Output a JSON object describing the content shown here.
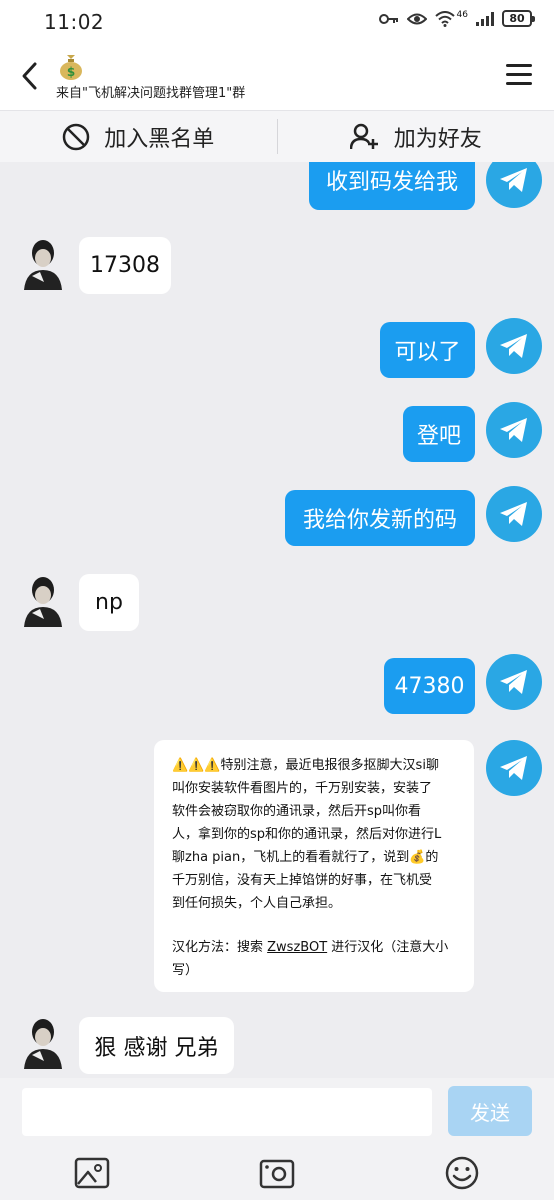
{
  "status_bar": {
    "time": "11:02",
    "battery": "80",
    "network": "46"
  },
  "header": {
    "subtitle": "来自\"飞机解决问题找群管理1\"群",
    "avatar_icon": "money-bag-icon"
  },
  "actions": {
    "blacklist_label": "加入黑名单",
    "add_friend_label": "加为好友"
  },
  "messages": {
    "m1": "收到码发给我",
    "m2": "17308",
    "m3": "可以了",
    "m4": "登吧",
    "m5": "我给你发新的码",
    "m6": "np",
    "m7": "47380",
    "m9": "狠 感谢 兄弟"
  },
  "notice": {
    "line1": "⚠️⚠️⚠️特别注意，最近电报很多抠脚大汉si聊",
    "line2": "叫你安装软件看图片的，千万别安装，安装了",
    "line3": "软件会被窃取你的通讯录，然后开sp叫你看",
    "line4": "人，拿到你的sp和你的通讯录，然后对你进行L",
    "line5": "聊zha pian，飞机上的看看就行了，说到💰的",
    "line6": "千万别信，没有天上掉馅饼的好事，在飞机受",
    "line7": "到任何损失，个人自己承担。",
    "line8_pre": "汉化方法：搜索 ",
    "line8_link": "ZwszBOT",
    "line8_post": " 进行汉化（注意大小",
    "line9": "写）"
  },
  "input": {
    "placeholder": "",
    "send_label": "发送"
  },
  "colors": {
    "outgoing_bubble": "#1b9df0",
    "telegram_avatar": "#2aa7e4",
    "send_disabled": "#a9d4f3"
  }
}
